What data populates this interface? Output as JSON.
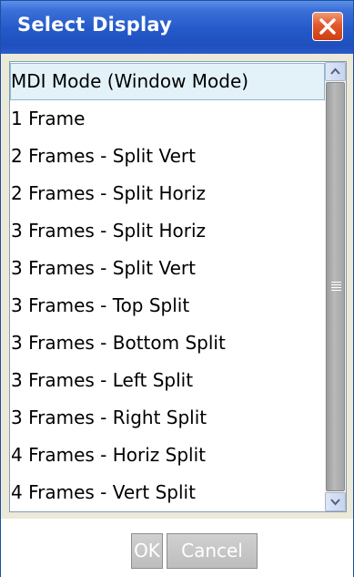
{
  "window": {
    "title": "Select Display"
  },
  "list": {
    "items": [
      {
        "label": "MDI Mode (Window Mode)",
        "selected": true
      },
      {
        "label": "1 Frame",
        "selected": false
      },
      {
        "label": "2 Frames - Split Vert",
        "selected": false
      },
      {
        "label": "2 Frames - Split Horiz",
        "selected": false
      },
      {
        "label": "3 Frames - Split Horiz",
        "selected": false
      },
      {
        "label": "3 Frames - Split Vert",
        "selected": false
      },
      {
        "label": "3 Frames - Top Split",
        "selected": false
      },
      {
        "label": "3 Frames - Bottom Split",
        "selected": false
      },
      {
        "label": "3 Frames - Left Split",
        "selected": false
      },
      {
        "label": "3 Frames - Right Split",
        "selected": false
      },
      {
        "label": "4 Frames - Horiz Split",
        "selected": false
      },
      {
        "label": "4 Frames - Vert Split",
        "selected": false
      }
    ]
  },
  "buttons": {
    "ok_label": "OK",
    "cancel_label": "Cancel"
  },
  "icons": {
    "close": "close-icon",
    "scroll_up": "arrow-up-icon",
    "scroll_down": "arrow-down-icon",
    "thumb_grip": "grip-icon"
  },
  "colors": {
    "title_bar": "#2458c9",
    "close_button": "#e2572c",
    "selection": "#e3f2f9",
    "dialog_face": "#ece9d8"
  }
}
